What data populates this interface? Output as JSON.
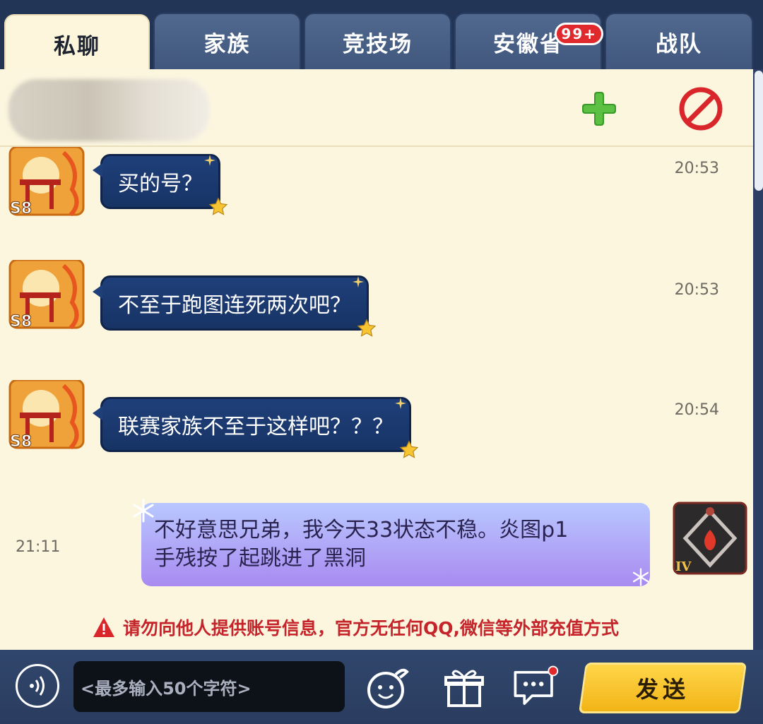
{
  "tabs": [
    {
      "label": "私聊",
      "active": true
    },
    {
      "label": "家族",
      "active": false
    },
    {
      "label": "竞技场",
      "active": false
    },
    {
      "label": "安徽省",
      "active": false,
      "badge": "99+"
    },
    {
      "label": "战队",
      "active": false
    }
  ],
  "header": {
    "add_icon": "plus-icon",
    "block_icon": "prohibit-icon"
  },
  "messages": [
    {
      "from": "other",
      "text": "买的号？",
      "time": "20:53",
      "avatar_badge": "S8"
    },
    {
      "from": "other",
      "text": "不至于跑图连死两次吧？",
      "time": "20:53",
      "avatar_badge": "S8"
    },
    {
      "from": "other",
      "text": "联赛家族不至于这样吧？？？",
      "time": "20:54",
      "avatar_badge": "S8"
    },
    {
      "from": "me",
      "line1": "不好意思兄弟，我今天33状态不稳。炎图p1",
      "line2": "手残按了起跳进了黑洞",
      "time": "21:11",
      "avatar_badge": "IV"
    }
  ],
  "warning": "请勿向他人提供账号信息，官方无任何QQ,微信等外部充值方式",
  "composer": {
    "placeholder": "<最多输入50个字符>",
    "send_label": "发送"
  },
  "colors": {
    "panel_bg": "#fcf6df",
    "bubble_other": "#1f3f7a",
    "bubble_mine": "#b39dfa",
    "warning": "#c4242a",
    "send_button": "#f6c227"
  }
}
